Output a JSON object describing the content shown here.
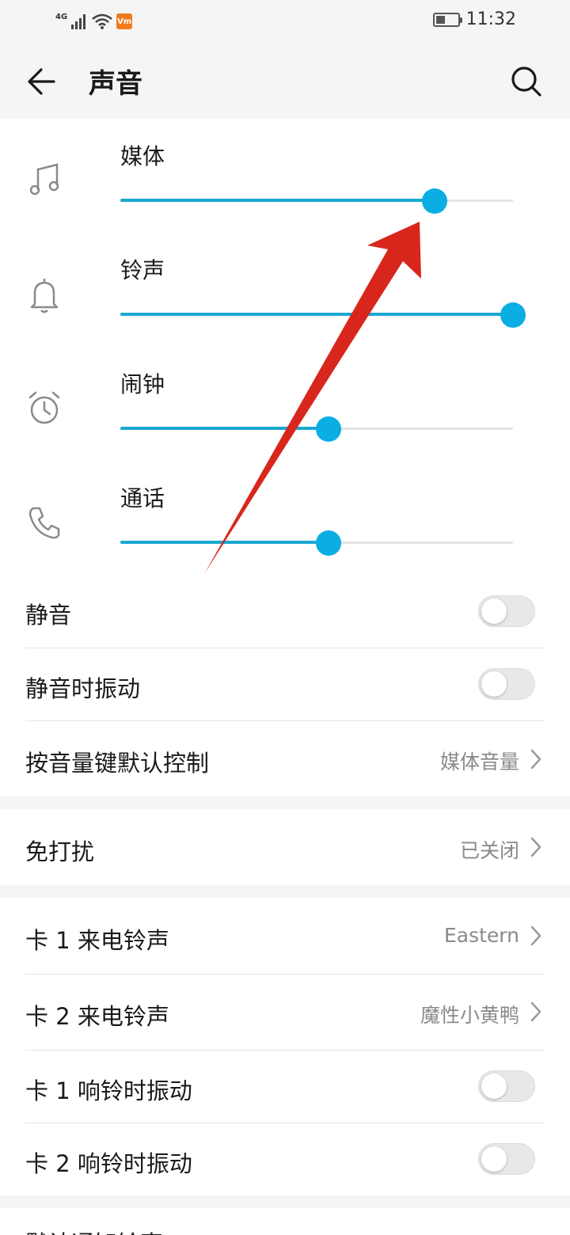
{
  "status_bar": {
    "network": "4G",
    "app_badge": "Vm",
    "time": "11:32",
    "battery_level": 0.45
  },
  "header": {
    "title": "声音",
    "back_icon": "back-arrow-icon",
    "search_icon": "search-icon"
  },
  "volume": [
    {
      "label": "媒体",
      "icon": "music-note-icon",
      "level": 0.8
    },
    {
      "label": "铃声",
      "icon": "bell-icon",
      "level": 1.0
    },
    {
      "label": "闹钟",
      "icon": "alarm-clock-icon",
      "level": 0.53
    },
    {
      "label": "通话",
      "icon": "phone-icon",
      "level": 0.53
    }
  ],
  "settings": {
    "mute": {
      "label": "静音",
      "enabled": false
    },
    "vibrate_when_muted": {
      "label": "静音时振动",
      "enabled": false
    },
    "volume_key_default": {
      "label": "按音量键默认控制",
      "value": "媒体音量"
    },
    "do_not_disturb": {
      "label": "免打扰",
      "value": "已关闭"
    },
    "sim1_ringtone": {
      "label": "卡 1 来电铃声",
      "value": "Eastern"
    },
    "sim2_ringtone": {
      "label": "卡 2 来电铃声",
      "value": "魔性小黄鸭"
    },
    "sim1_vibrate": {
      "label": "卡 1 响铃时振动",
      "enabled": false
    },
    "sim2_vibrate": {
      "label": "卡 2 响铃时振动",
      "enabled": false
    },
    "default_notification": {
      "label": "默认通知铃声"
    }
  },
  "colors": {
    "accent": "#0aaee3",
    "slider_fill": "#1aa8d0",
    "annotation_arrow": "#d9261c",
    "background": "#f5f5f5",
    "card": "#ffffff"
  }
}
